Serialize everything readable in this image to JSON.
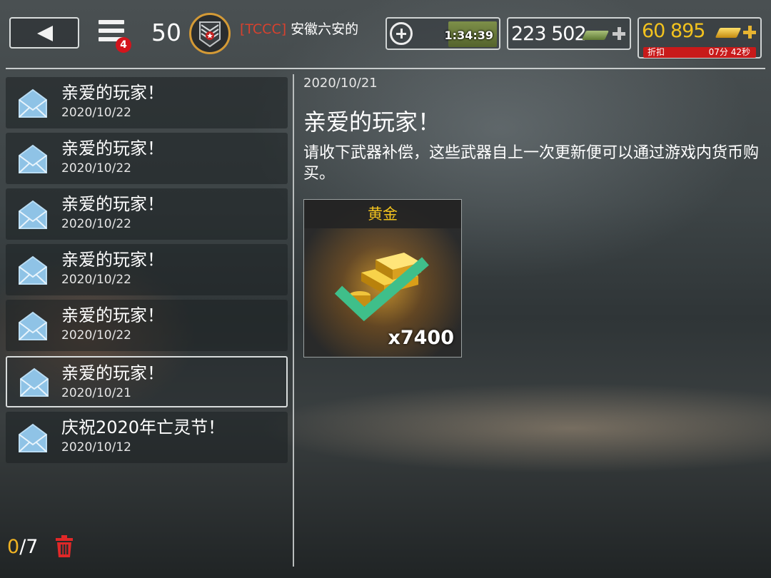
{
  "header": {
    "back_icon": "back-arrow-icon",
    "menu_icon": "hamburger-menu-icon",
    "menu_badge": "4",
    "player_level": "50",
    "rank_icon": "rank-insignia-icon",
    "clan_tag": "[TCCC]",
    "player_name": "安徽六安的",
    "timer": "1:34:39",
    "cash_amount": "223 502",
    "gold_amount": "60 895",
    "discount_label": "折扣",
    "discount_time": "07分 42秒"
  },
  "mails": [
    {
      "title": "亲爱的玩家！",
      "date": "2020/10/22",
      "selected": false
    },
    {
      "title": "亲爱的玩家！",
      "date": "2020/10/22",
      "selected": false
    },
    {
      "title": "亲爱的玩家！",
      "date": "2020/10/22",
      "selected": false
    },
    {
      "title": "亲爱的玩家！",
      "date": "2020/10/22",
      "selected": false
    },
    {
      "title": "亲爱的玩家！",
      "date": "2020/10/22",
      "selected": false
    },
    {
      "title": "亲爱的玩家！",
      "date": "2020/10/21",
      "selected": true
    },
    {
      "title": "庆祝2020年亡灵节！",
      "date": "2020/10/12",
      "selected": false
    }
  ],
  "footer": {
    "read_count": "0",
    "total_count": "/7",
    "trash_icon": "trash-icon"
  },
  "detail": {
    "date": "2020/10/21",
    "title": "亲爱的玩家！",
    "body": "请收下武器补偿，这些武器自上一次更新便可以通过游戏内货币购买。",
    "reward": {
      "label": "黄金",
      "quantity": "x7400",
      "claimed": true
    }
  },
  "colors": {
    "gold": "#f2c21e",
    "badge_red": "#d4141c",
    "clan_tag": "#d8412e",
    "check_green": "#3fbf8a"
  }
}
